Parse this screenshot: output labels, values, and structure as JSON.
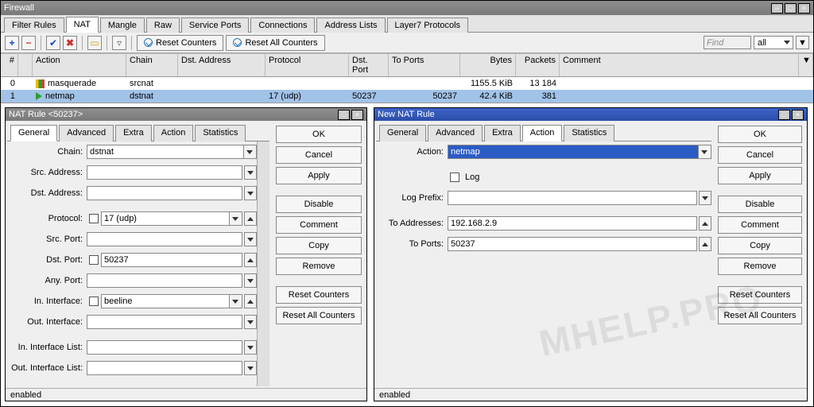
{
  "window": {
    "title": "Firewall"
  },
  "tabs": [
    "Filter Rules",
    "NAT",
    "Mangle",
    "Raw",
    "Service Ports",
    "Connections",
    "Address Lists",
    "Layer7 Protocols"
  ],
  "active_tab_index": 1,
  "toolbar": {
    "reset_counters": "Reset Counters",
    "reset_all_counters": "Reset All Counters",
    "find_placeholder": "Find",
    "filter_scope": "all"
  },
  "grid": {
    "headers": {
      "num": "#",
      "action": "Action",
      "chain": "Chain",
      "dst": "Dst. Address",
      "proto": "Protocol",
      "dport": "Dst. Port",
      "toports": "To Ports",
      "bytes": "Bytes",
      "packets": "Packets",
      "comment": "Comment"
    },
    "rows": [
      {
        "num": "0",
        "icon": "masq",
        "action": "masquerade",
        "chain": "srcnat",
        "dst": "",
        "proto": "",
        "dport": "",
        "toports": "",
        "bytes": "1155.5 KiB",
        "packets": "13 184",
        "comment": ""
      },
      {
        "num": "1",
        "icon": "netm",
        "action": "netmap",
        "chain": "dstnat",
        "dst": "",
        "proto": "17 (udp)",
        "dport": "50237",
        "toports": "50237",
        "bytes": "42.4 KiB",
        "packets": "381",
        "comment": "",
        "selected": true
      }
    ]
  },
  "left_dialog": {
    "title": "NAT Rule <50237>",
    "tabs": [
      "General",
      "Advanced",
      "Extra",
      "Action",
      "Statistics"
    ],
    "active_tab_index": 0,
    "fields": {
      "chain_label": "Chain:",
      "chain": "dstnat",
      "src_addr_label": "Src. Address:",
      "src_addr": "",
      "dst_addr_label": "Dst. Address:",
      "dst_addr": "",
      "protocol_label": "Protocol:",
      "protocol": "17 (udp)",
      "src_port_label": "Src. Port:",
      "src_port": "",
      "dst_port_label": "Dst. Port:",
      "dst_port": "50237",
      "any_port_label": "Any. Port:",
      "any_port": "",
      "in_iface_label": "In. Interface:",
      "in_iface": "beeline",
      "out_iface_label": "Out. Interface:",
      "out_iface": "",
      "in_iface_list_label": "In. Interface List:",
      "in_iface_list": "",
      "out_iface_list_label": "Out. Interface List:",
      "out_iface_list": ""
    },
    "buttons": {
      "ok": "OK",
      "cancel": "Cancel",
      "apply": "Apply",
      "disable": "Disable",
      "comment": "Comment",
      "copy": "Copy",
      "remove": "Remove",
      "reset_counters": "Reset Counters",
      "reset_all_counters": "Reset All Counters"
    },
    "status": "enabled"
  },
  "right_dialog": {
    "title": "New NAT Rule",
    "tabs": [
      "General",
      "Advanced",
      "Extra",
      "Action",
      "Statistics"
    ],
    "active_tab_index": 3,
    "fields": {
      "action_label": "Action:",
      "action": "netmap",
      "log_label": "Log",
      "log_prefix_label": "Log Prefix:",
      "log_prefix": "",
      "to_addr_label": "To Addresses:",
      "to_addr": "192.168.2.9",
      "to_ports_label": "To Ports:",
      "to_ports": "50237"
    },
    "buttons": {
      "ok": "OK",
      "cancel": "Cancel",
      "apply": "Apply",
      "disable": "Disable",
      "comment": "Comment",
      "copy": "Copy",
      "remove": "Remove",
      "reset_counters": "Reset Counters",
      "reset_all_counters": "Reset All Counters"
    },
    "status": "enabled"
  },
  "watermark": "MHELP.PRO"
}
